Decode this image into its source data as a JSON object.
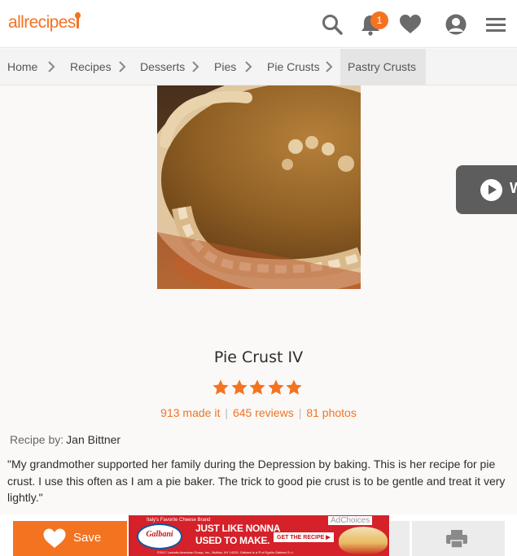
{
  "header": {
    "logo_text": "allrecipes",
    "notification_count": "1",
    "icons": [
      "search-icon",
      "bell-icon",
      "heart-icon",
      "user-icon",
      "menu-icon"
    ],
    "accent_color": "#f47321"
  },
  "breadcrumb": [
    "Home",
    "Recipes",
    "Desserts",
    "Pies",
    "Pie Crusts",
    "Pastry Crusts"
  ],
  "video": {
    "label_visible": "W"
  },
  "recipe": {
    "title": "Pie Crust IV",
    "rating_stars": 5,
    "made_it": "913 made it",
    "reviews": "645 reviews",
    "photos": "81 photos",
    "author_label": "Recipe by:",
    "author_name": "Jan Bittner",
    "description": "\"My grandmother supported her family during the Depression by baking. This is her recipe for pie crust. I use this often as I am a pie baker. The trick to good pie crust is to be gentle and treat it very lightly.\""
  },
  "bottom_bar": {
    "save_label": "Save",
    "ad": {
      "brand": "Galbani",
      "tagline": "Italy's Favorite Cheese Brand",
      "headline_1": "JUST LIKE NONNA",
      "headline_2": "USED TO MAKE.",
      "cta": "GET THE RECIPE ▶",
      "adchoices": "AdChoices",
      "fine_print": "©2017 Lactalis American Group, Inc., Buffalo, NY 14220. Galbani is a ® of Egidio Galbani S.r.l."
    }
  }
}
